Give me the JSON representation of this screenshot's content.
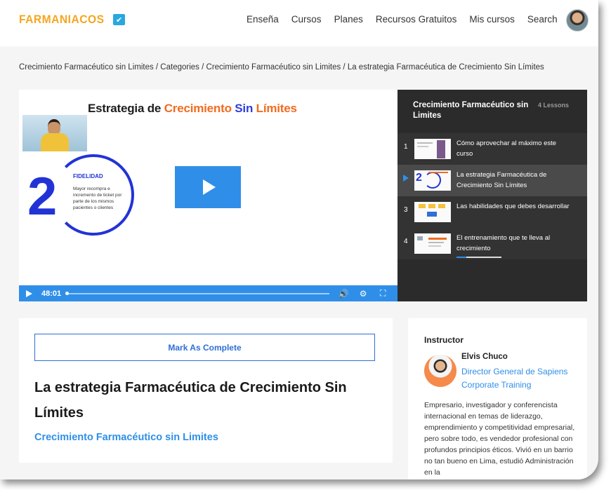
{
  "header": {
    "logo_text": "FARMANIACOS",
    "nav": [
      "Enseña",
      "Cursos",
      "Planes",
      "Recursos Gratuitos",
      "Mis cursos",
      "Search"
    ]
  },
  "breadcrumb": "Crecimiento Farmacéutico sin Limites / Categories / Crecimiento Farmacéutico sin Limites / La estrategia Farmacéutica de Crecimiento Sin Límites",
  "video": {
    "slide_title_1": "Estrategia de ",
    "slide_title_2": "Crecimiento ",
    "slide_title_3": "Sin ",
    "slide_title_4": "Límites",
    "slide_number": "2",
    "slide_heading": "FIDELIDAD",
    "slide_text": "Mayor recompra e incremento de ticket por parte de los mismos pacientes o clientes",
    "time": "48:01",
    "progress": 0.0
  },
  "playlist": {
    "title": "Crecimiento Farmacéutico sin Limites",
    "count": "4 Lessons",
    "items": [
      {
        "num": "1",
        "label": "Cómo aprovechar al máximo este curso"
      },
      {
        "num": "",
        "label": "La estrategia Farmacéutica de Crecimiento Sin Límites"
      },
      {
        "num": "3",
        "label": "Las habilidades que debes desarrollar"
      },
      {
        "num": "4",
        "label": "El entrenamiento que te lleva al crecimiento",
        "progress": 0.22
      }
    ]
  },
  "lesson": {
    "mark_complete": "Mark As Complete",
    "title": "La estrategia Farmacéutica de Crecimiento Sin Límites",
    "course_link": "Crecimiento Farmacéutico sin Limites"
  },
  "instructor": {
    "heading": "Instructor",
    "name": "Elvis Chuco",
    "role": "Director General de Sapiens Corporate Training",
    "bio": "Empresario, investigador y conferencista internacional en temas de liderazgo, emprendimiento y competitividad empresarial, pero sobre todo, es vendedor profesional con profundos principios éticos. Vivió en un barrio no tan bueno en Lima, estudió Administración en la"
  },
  "colors": {
    "accent": "#2f8fe8",
    "logo": "#f5a623",
    "playlist_bg": "#2b2b2b"
  }
}
